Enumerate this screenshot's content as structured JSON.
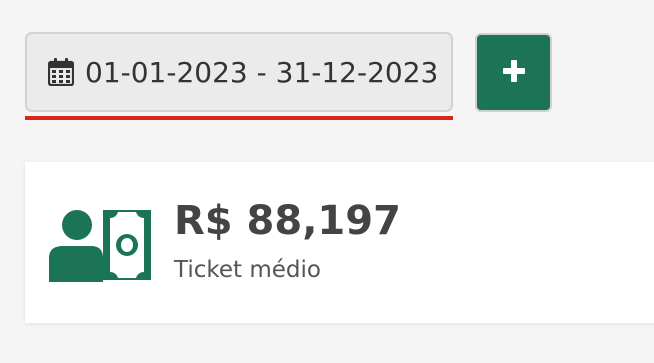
{
  "filter": {
    "date_range": "01-01-2023 - 31-12-2023",
    "calendar_icon": "calendar-icon",
    "add_icon": "plus-icon"
  },
  "kpi_card": {
    "value": "R$ 88,197",
    "label": "Ticket médio",
    "icon": "person-money-icon"
  },
  "colors": {
    "accent_green": "#1c7456",
    "underline_red": "#d9261c",
    "text_dark": "#444444"
  }
}
